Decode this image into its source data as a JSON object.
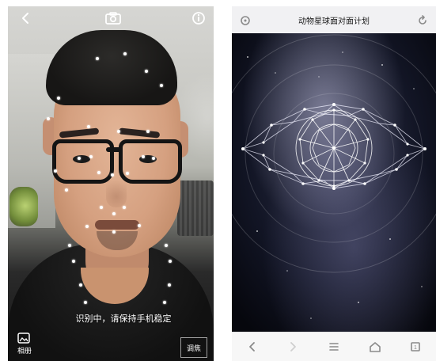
{
  "left_screen": {
    "status_text": "识别中，请保持手机稳定",
    "album_label": "相册",
    "frame_button_label": "调焦",
    "icons": [
      "back-icon",
      "camera-icon",
      "info-icon",
      "album-icon"
    ]
  },
  "right_screen": {
    "title": "动物星球面对面计划",
    "icons": [
      "settings-icon",
      "refresh-icon"
    ],
    "nav_icons": [
      "back-nav-icon",
      "forward-nav-icon",
      "menu-nav-icon",
      "home-nav-icon",
      "tabs-nav-icon"
    ],
    "tabs_count": "1"
  },
  "colors": {
    "accent": "#ffffff",
    "galaxy_bg": "#0b0c17",
    "nav_bg": "#f7f7f7"
  }
}
